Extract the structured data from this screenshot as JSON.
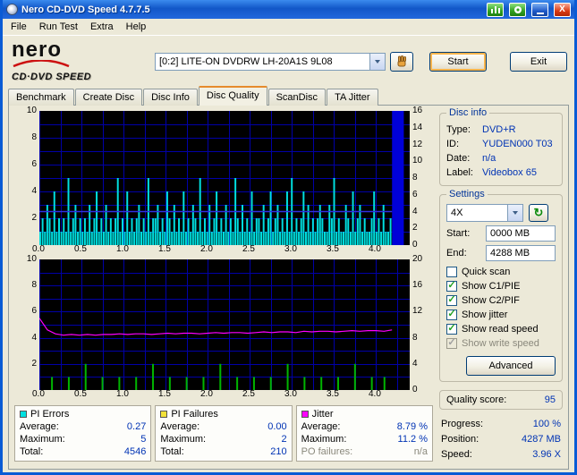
{
  "window": {
    "title": "Nero CD-DVD Speed 4.7.7.5"
  },
  "menu": {
    "items": [
      "File",
      "Run Test",
      "Extra",
      "Help"
    ]
  },
  "brand": {
    "name": "nero",
    "product": "CD·DVD SPEED"
  },
  "toolbar": {
    "drive": "[0:2]  LITE-ON DVDRW LH-20A1S 9L08",
    "start_label": "Start",
    "exit_label": "Exit"
  },
  "tabs": {
    "items": [
      "Benchmark",
      "Create Disc",
      "Disc Info",
      "Disc Quality",
      "ScanDisc",
      "TA Jitter"
    ],
    "active": "Disc Quality"
  },
  "disc_info": {
    "title": "Disc info",
    "rows": [
      {
        "label": "Type:",
        "value": "DVD+R"
      },
      {
        "label": "ID:",
        "value": "YUDEN000 T03"
      },
      {
        "label": "Date:",
        "value": "n/a"
      },
      {
        "label": "Label:",
        "value": "Videobox 65"
      }
    ]
  },
  "settings": {
    "title": "Settings",
    "speed": "4X",
    "start_label": "Start:",
    "start_value": "0000 MB",
    "end_label": "End:",
    "end_value": "4288 MB",
    "checkboxes": [
      {
        "label": "Quick scan",
        "checked": false,
        "enabled": true
      },
      {
        "label": "Show C1/PIE",
        "checked": true,
        "enabled": true
      },
      {
        "label": "Show C2/PIF",
        "checked": true,
        "enabled": true
      },
      {
        "label": "Show jitter",
        "checked": true,
        "enabled": true
      },
      {
        "label": "Show read speed",
        "checked": true,
        "enabled": true
      },
      {
        "label": "Show write speed",
        "checked": true,
        "enabled": false
      }
    ],
    "advanced_label": "Advanced"
  },
  "quality": {
    "label": "Quality score:",
    "value": "95"
  },
  "progress": {
    "rows": [
      {
        "label": "Progress:",
        "value": "100 %"
      },
      {
        "label": "Position:",
        "value": "4287 MB"
      },
      {
        "label": "Speed:",
        "value": "3.96 X"
      }
    ]
  },
  "stats": {
    "panels": [
      {
        "name": "PI Errors",
        "swatch": "#00E0E0",
        "rows": [
          [
            "Average:",
            "0.27"
          ],
          [
            "Maximum:",
            "5"
          ],
          [
            "Total:",
            "4546"
          ]
        ]
      },
      {
        "name": "PI Failures",
        "swatch": "#F2E23A",
        "rows": [
          [
            "Average:",
            "0.00"
          ],
          [
            "Maximum:",
            "2"
          ],
          [
            "Total:",
            "210"
          ]
        ]
      },
      {
        "name": "Jitter",
        "swatch": "#FF00FF",
        "rows": [
          [
            "Average:",
            "8.79 %"
          ],
          [
            "Maximum:",
            "11.2 %"
          ],
          [
            "PO failures:",
            "n/a"
          ]
        ]
      }
    ]
  },
  "chart_data": [
    {
      "type": "bar",
      "id": "chart-top",
      "title": "PI Errors (cyan bars, left axis) with read speed line (right axis)",
      "x_max": 4.4,
      "data_end": 4.19,
      "x_ticks": [
        0,
        0.5,
        1,
        1.5,
        2,
        2.5,
        3,
        3.5,
        4
      ],
      "left_axis": {
        "max": 10,
        "ticks": [
          10,
          8,
          6,
          4,
          2
        ]
      },
      "right_axis": {
        "max": 16,
        "ticks": [
          16,
          14,
          12,
          10,
          8,
          6,
          4,
          2,
          0
        ]
      },
      "grid": {
        "x_step": 0.25,
        "y_divisions": 10,
        "color": "#0000A8"
      },
      "bg": "#000000",
      "end_block": {
        "from": 4.19,
        "to": 4.33,
        "color": "#0000D8"
      },
      "series": [
        {
          "name": "PI Errors",
          "kind": "bars",
          "axis": "left",
          "color": "#00E0E0",
          "values": [
            1,
            2,
            1,
            3,
            2,
            1,
            4,
            1,
            2,
            1,
            2,
            1,
            5,
            1,
            2,
            3,
            1,
            2,
            1,
            2,
            1,
            3,
            1,
            2,
            4,
            1,
            2,
            1,
            3,
            1,
            2,
            1,
            2,
            5,
            1,
            2,
            1,
            4,
            1,
            2,
            1,
            2,
            3,
            1,
            2,
            1,
            5,
            1,
            2,
            2,
            3,
            1,
            2,
            1,
            4,
            2,
            1,
            3,
            1,
            2,
            1,
            4,
            1,
            2,
            1,
            3,
            2,
            1,
            5,
            1,
            2,
            1,
            3,
            1,
            2,
            4,
            1,
            2,
            1,
            3,
            1,
            2,
            1,
            5,
            2,
            1,
            3,
            1,
            2,
            1,
            4,
            1,
            2,
            2,
            1,
            3,
            1,
            2,
            4,
            1,
            2,
            3,
            1,
            2,
            1,
            4,
            1,
            5,
            1,
            2,
            1,
            2,
            4,
            1,
            3,
            1,
            2,
            1,
            2,
            3,
            2,
            1,
            1,
            3,
            2,
            5,
            1,
            2,
            1,
            1,
            3,
            2,
            1,
            4,
            1,
            2,
            3,
            1,
            2,
            1,
            1,
            2,
            4,
            1,
            2,
            1,
            3,
            1,
            1,
            2
          ]
        },
        {
          "name": "Read Speed",
          "kind": "line-const",
          "axis": "right",
          "color": "#3030E0",
          "value": 4
        }
      ]
    },
    {
      "type": "bar",
      "id": "chart-bottom",
      "title": "PI Failures (green spikes, left axis) with jitter line (right axis, %)",
      "x_max": 4.4,
      "data_end": 4.19,
      "x_ticks": [
        0,
        0.5,
        1,
        1.5,
        2,
        2.5,
        3,
        3.5,
        4
      ],
      "left_axis": {
        "max": 10,
        "ticks": [
          10,
          8,
          6,
          4,
          2
        ]
      },
      "right_axis": {
        "max": 20,
        "ticks": [
          20,
          16,
          12,
          8,
          4,
          0
        ]
      },
      "grid": {
        "x_step": 0.25,
        "y_divisions": 10,
        "color": "#0000A8"
      },
      "bg": "#000000",
      "series": [
        {
          "name": "PI Failures",
          "kind": "spikes",
          "axis": "left",
          "color": "#00B400",
          "points": [
            [
              0.15,
              1
            ],
            [
              0.35,
              1
            ],
            [
              0.55,
              2
            ],
            [
              0.75,
              1
            ],
            [
              0.95,
              1
            ],
            [
              1.15,
              1
            ],
            [
              1.35,
              2
            ],
            [
              1.55,
              1
            ],
            [
              1.75,
              1
            ],
            [
              1.95,
              1
            ],
            [
              2.15,
              2
            ],
            [
              2.35,
              1
            ],
            [
              2.55,
              1
            ],
            [
              2.75,
              1
            ],
            [
              2.95,
              2
            ],
            [
              3.15,
              1
            ],
            [
              3.35,
              1
            ],
            [
              3.55,
              1
            ],
            [
              3.75,
              2
            ],
            [
              3.95,
              1
            ],
            [
              4.1,
              1
            ]
          ]
        },
        {
          "name": "Jitter",
          "kind": "line",
          "axis": "right",
          "color": "#FF00FF",
          "values": [
            11.0,
            9.2,
            8.6,
            8.4,
            8.5,
            8.4,
            8.5,
            8.4,
            8.5,
            8.5,
            8.6,
            8.5,
            8.6,
            8.6,
            8.5,
            8.6,
            8.7,
            8.6,
            8.7,
            8.7,
            8.6,
            8.7,
            8.8,
            8.7,
            8.8,
            8.8,
            8.7,
            8.8,
            8.9,
            8.8,
            8.9,
            8.9,
            8.8,
            9.0,
            8.9,
            9.0,
            9.0,
            8.9,
            9.0,
            9.1,
            9.0,
            9.1,
            9.1,
            9.0,
            9.2
          ]
        }
      ]
    }
  ]
}
